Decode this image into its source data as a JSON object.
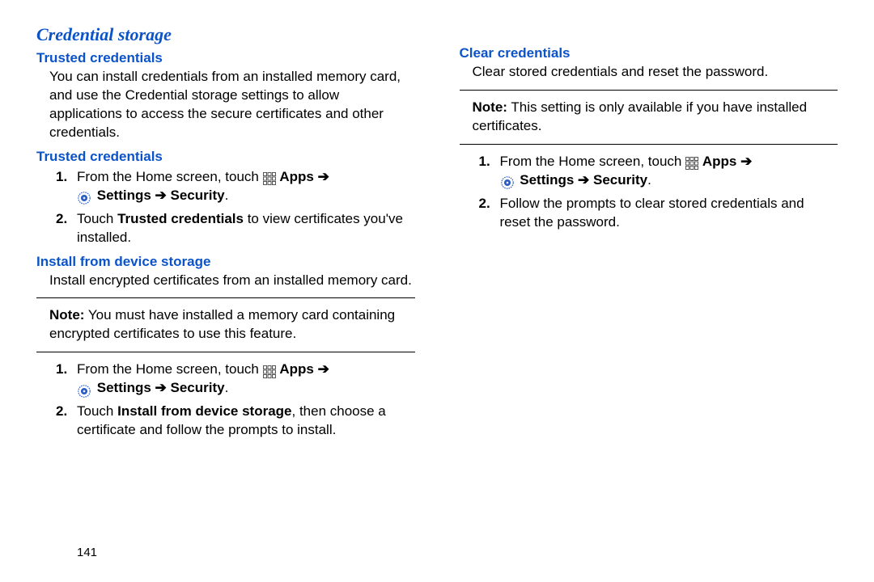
{
  "page_number": "141",
  "labels": {
    "apps": "Apps",
    "settings": "Settings",
    "security": "Security",
    "arrow": "➔",
    "note": "Note:"
  },
  "left": {
    "section_title": "Credential storage",
    "trusted1": {
      "heading": "Trusted credentials",
      "body": "You can install credentials from an installed memory card, and use the Credential storage settings to allow applications to access the secure certificates and other credentials."
    },
    "trusted2": {
      "heading": "Trusted credentials",
      "step1_pre": "From the Home screen, touch ",
      "step2_pre": "Touch ",
      "step2_bold": "Trusted credentials",
      "step2_post": " to view certificates you've installed."
    },
    "install": {
      "heading": "Install from device storage",
      "body": "Install encrypted certificates from an installed memory card.",
      "note": "You must have installed a memory card containing encrypted certificates to use this feature.",
      "step1_pre": "From the Home screen, touch ",
      "step2_pre": "Touch ",
      "step2_bold": "Install from device storage",
      "step2_post": ", then choose a certificate and follow the prompts to install."
    }
  },
  "right": {
    "clear": {
      "heading": "Clear credentials",
      "body": "Clear stored credentials and reset the password.",
      "note": "This setting is only available if you have installed certificates.",
      "step1_pre": "From the Home screen, touch ",
      "step2": "Follow the prompts to clear stored credentials and reset the password."
    }
  }
}
